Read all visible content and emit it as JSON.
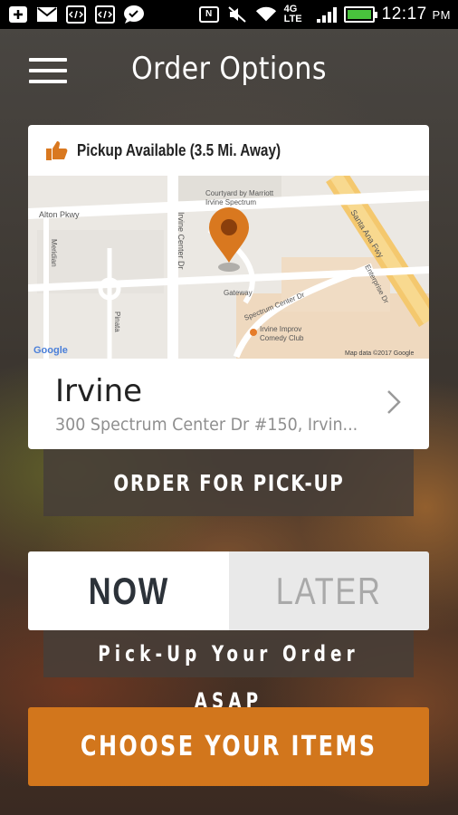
{
  "status_bar": {
    "time": "12:17",
    "ampm": "PM",
    "network": "4G LTE",
    "icons": [
      "add-icon",
      "gmail-icon",
      "code-icon",
      "code-icon",
      "chat-icon",
      "nfc-icon",
      "mute-icon",
      "wifi-icon",
      "signal-icon",
      "battery-icon"
    ]
  },
  "header": {
    "title": "Order Options",
    "menu_icon": "hamburger-menu-icon"
  },
  "location_card": {
    "availability_icon": "thumbs-up-icon",
    "availability_text": "Pickup Available (3.5 Mi. Away)",
    "map": {
      "labels": [
        "Alton Pkwy",
        "Meridian",
        "Irvine Center Dr",
        "Courtyard by Marriott Irvine Spectrum",
        "Santa Ana Fwy",
        "Enterprise Dr",
        "Gateway",
        "Spectrum Center Dr",
        "Irvine Improv Comedy Club",
        "Pinata",
        "Google",
        "Map data ©2017 Google"
      ],
      "pin_color": "#d9781f"
    },
    "store_name": "Irvine",
    "store_address": "300 Spectrum Center Dr #150, Irvin...",
    "chevron_icon": "chevron-right-icon"
  },
  "order_type_button": "ORDER FOR PICK-UP",
  "time_toggle": {
    "options": [
      "NOW",
      "LATER"
    ],
    "selected": "NOW"
  },
  "time_caption": "Pick-Up Your Order ASAP",
  "cta_button": "CHOOSE YOUR ITEMS",
  "colors": {
    "accent": "#d2761c",
    "dark_text": "#2c3239",
    "muted_text": "#a9a9a9"
  }
}
